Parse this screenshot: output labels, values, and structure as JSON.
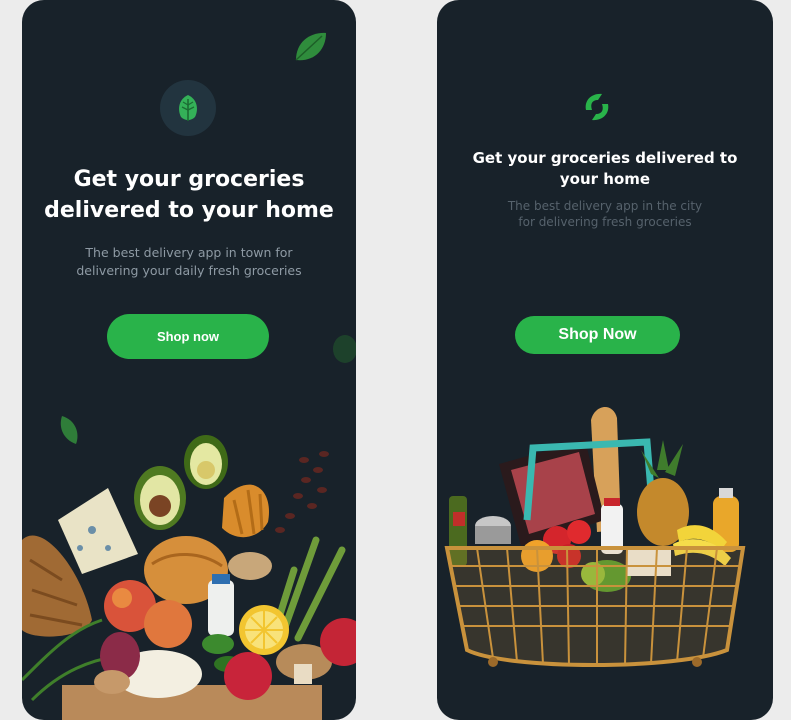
{
  "left_screen": {
    "headline": "Get your groceries delivered to your home",
    "subtitle": "The best delivery app in town for delivering your daily fresh groceries",
    "cta_label": "Shop now",
    "logo_icon": "leaf-icon"
  },
  "right_screen": {
    "headline": "Get your groceries delivered to your home",
    "subtitle": "The best delivery app in the city for delivering fresh groceries",
    "cta_label": "Shop Now",
    "logo_icon": "refresh-leaf-icon"
  },
  "colors": {
    "background": "#ececec",
    "screen": "#18222a",
    "accent": "#29b34a",
    "headline": "#ffffff",
    "subtitle_left": "#8e9aa4",
    "subtitle_right": "#56626c"
  },
  "illustrations": [
    "groceries-pile-image",
    "shopping-basket-image"
  ]
}
